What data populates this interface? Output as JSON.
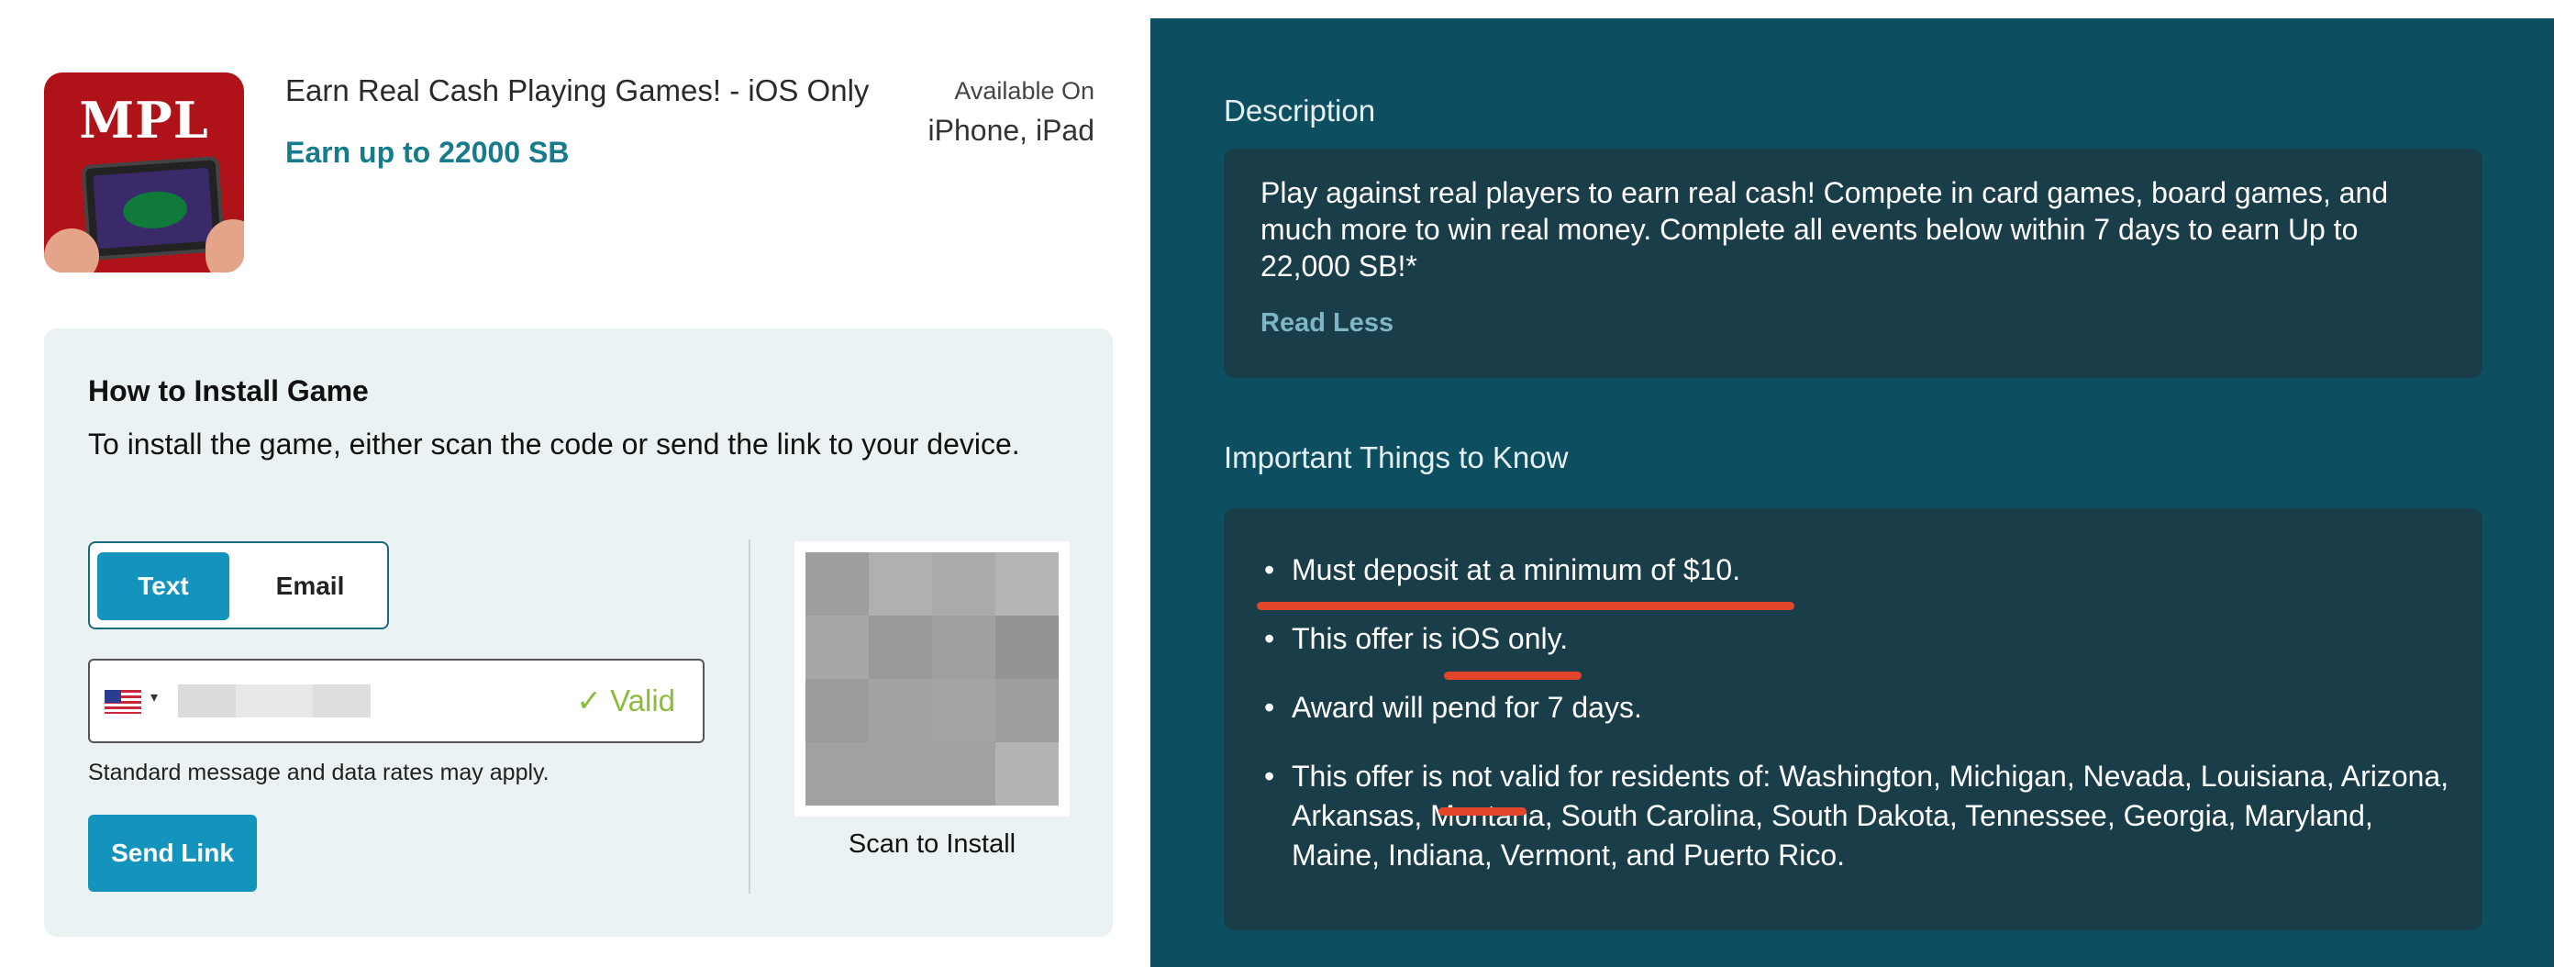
{
  "app": {
    "title": "Earn Real Cash Playing Games! - iOS Only",
    "earn": "Earn up to 22000 SB",
    "available_label": "Available On",
    "available_devices": "iPhone, iPad",
    "icon_logo_text": "MPL"
  },
  "install": {
    "title": "How to Install Game",
    "description": "To install the game, either scan the code or send the link to your device.",
    "tabs": [
      "Text",
      "Email"
    ],
    "active_tab": "Text",
    "valid_text": "✓ Valid",
    "rates_note": "Standard message and data rates may apply.",
    "send_button": "Send Link",
    "scan_label": "Scan to Install",
    "flag_caret": "▾"
  },
  "description": {
    "heading": "Description",
    "text": "Play against real players to earn real cash! Compete in card games, board games, and much more to win real money. Complete all events below within 7 days to earn Up to 22,000 SB!*",
    "toggle": "Read Less"
  },
  "important": {
    "heading": "Important Things to Know",
    "bullet_char": "•",
    "items": [
      "Must deposit at a minimum of $10.",
      "This offer is iOS only.",
      "Award will pend for 7 days.",
      "This offer is not valid for residents of: Washington, Michigan, Nevada, Louisiana, Arizona, Arkansas, Montana, South Carolina, South Dakota, Tennessee, Georgia, Maryland, Maine, Indiana, Vermont, and Puerto Rico."
    ]
  },
  "colors": {
    "accent": "#1494bd",
    "earn": "#167b8c",
    "right_bg": "#0d4f61",
    "card_bg": "#1a3d4a",
    "valid": "#8bbd3a",
    "annotation": "#e2452a"
  },
  "qr_shades": [
    "#9e9e9e",
    "#b0b0b0",
    "#aaaaaa",
    "#b5b5b5",
    "#a7a7a7",
    "#999999",
    "#a0a0a0",
    "#949494",
    "#9b9b9b",
    "#a3a3a3",
    "#a5a5a5",
    "#9d9d9d",
    "#a1a1a1",
    "#a1a1a1",
    "#a1a1a1",
    "#b3b3b3"
  ]
}
